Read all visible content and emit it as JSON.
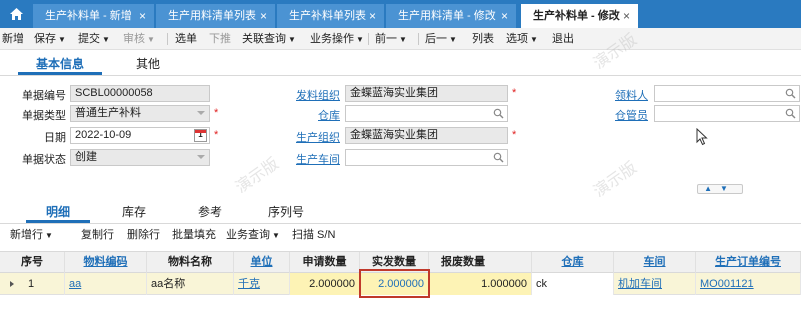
{
  "tabs": [
    {
      "label": "生产补料单 - 新增",
      "active": false
    },
    {
      "label": "生产用料清单列表",
      "active": false
    },
    {
      "label": "生产补料单列表",
      "active": false
    },
    {
      "label": "生产用料清单 - 修改",
      "active": false
    },
    {
      "label": "生产补料单 - 修改",
      "active": true
    }
  ],
  "close_glyph": "×",
  "toolbar": [
    {
      "label": "新增",
      "dropdown": false,
      "disabled": false
    },
    {
      "label": "保存",
      "dropdown": true,
      "disabled": false
    },
    {
      "label": "提交",
      "dropdown": true,
      "disabled": false
    },
    {
      "label": "审核",
      "dropdown": true,
      "disabled": true
    },
    {
      "label": "选单",
      "dropdown": false,
      "disabled": false
    },
    {
      "label": "下推",
      "dropdown": false,
      "disabled": true
    },
    {
      "label": "关联查询",
      "dropdown": true,
      "disabled": false
    },
    {
      "label": "业务操作",
      "dropdown": true,
      "disabled": false
    },
    {
      "label": "前一",
      "dropdown": true,
      "disabled": false
    },
    {
      "label": "后一",
      "dropdown": true,
      "disabled": false
    },
    {
      "label": "列表",
      "dropdown": false,
      "disabled": false
    },
    {
      "label": "选项",
      "dropdown": true,
      "disabled": false
    },
    {
      "label": "退出",
      "dropdown": false,
      "disabled": false
    }
  ],
  "form_tabs": [
    "基本信息",
    "其他"
  ],
  "form": {
    "bill_no": {
      "label": "单据编号",
      "value": "SCBL00000058"
    },
    "bill_type": {
      "label": "单据类型",
      "value": "普通生产补料"
    },
    "date": {
      "label": "日期",
      "value": "2022-10-09",
      "cal_day": "1"
    },
    "status": {
      "label": "单据状态",
      "value": "创建"
    },
    "issue_org": {
      "label": "发料组织",
      "value": "金蝶蓝海实业集团"
    },
    "warehouse": {
      "label": "仓库",
      "value": ""
    },
    "prod_org": {
      "label": "生产组织",
      "value": "金蝶蓝海实业集团"
    },
    "workshop": {
      "label": "生产车间",
      "value": ""
    },
    "picker": {
      "label": "领料人",
      "value": ""
    },
    "keeper": {
      "label": "仓管员",
      "value": ""
    }
  },
  "required_mark": "*",
  "watermark": "演示版",
  "detail_tabs": [
    "明细",
    "库存",
    "参考",
    "序列号"
  ],
  "grid_toolbar": [
    {
      "label": "新增行",
      "dropdown": true
    },
    {
      "label": "复制行",
      "dropdown": false
    },
    {
      "label": "删除行",
      "dropdown": false
    },
    {
      "label": "批量填充",
      "dropdown": false
    },
    {
      "label": "业务查询",
      "dropdown": true
    },
    {
      "label": "扫描 S/N",
      "dropdown": false
    }
  ],
  "grid": {
    "columns": [
      {
        "label": "序号",
        "link": false
      },
      {
        "label": "物料编码",
        "link": true
      },
      {
        "label": "物料名称",
        "link": false
      },
      {
        "label": "单位",
        "link": true
      },
      {
        "label": "申请数量",
        "link": false
      },
      {
        "label": "实发数量",
        "link": false
      },
      {
        "label": "报废数量",
        "link": false
      },
      {
        "label": "仓库",
        "link": true
      },
      {
        "label": "车间",
        "link": true
      },
      {
        "label": "生产订单编号",
        "link": true
      }
    ],
    "rows": [
      [
        "1",
        "aa",
        "aa名称",
        "千克",
        "2.000000",
        "2.000000",
        "1.000000",
        "ck",
        "机加车间",
        "MO001121"
      ]
    ]
  },
  "colors": {
    "brand": "#2a7ac0",
    "link": "#1f6fb8",
    "row_highlight": "#f9f5d7",
    "annotation_box": "#c0392b"
  }
}
